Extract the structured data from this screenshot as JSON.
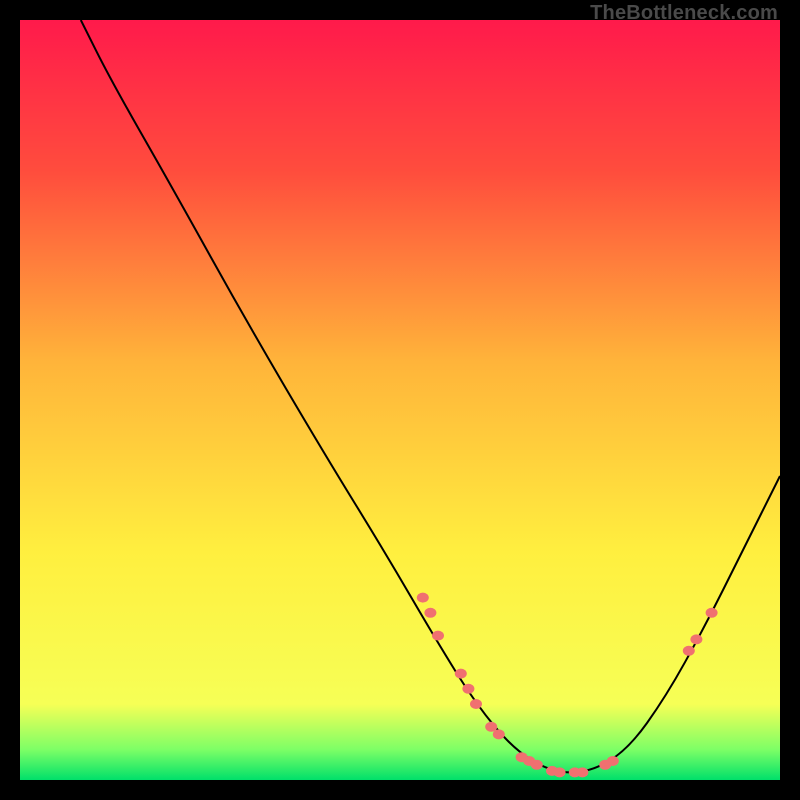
{
  "watermark": "TheBottleneck.com",
  "chart_data": {
    "type": "line",
    "title": "",
    "xlabel": "",
    "ylabel": "",
    "xlim": [
      0,
      100
    ],
    "ylim": [
      0,
      100
    ],
    "background_gradient": {
      "stops": [
        {
          "offset": 0,
          "color": "#ff1a4b"
        },
        {
          "offset": 20,
          "color": "#ff4d3d"
        },
        {
          "offset": 45,
          "color": "#ffb43a"
        },
        {
          "offset": 70,
          "color": "#ffef3f"
        },
        {
          "offset": 90,
          "color": "#f6ff56"
        },
        {
          "offset": 96,
          "color": "#7dff66"
        },
        {
          "offset": 100,
          "color": "#00e06a"
        }
      ]
    },
    "curve": [
      {
        "x": 8,
        "y": 100
      },
      {
        "x": 12,
        "y": 92
      },
      {
        "x": 20,
        "y": 78
      },
      {
        "x": 30,
        "y": 60
      },
      {
        "x": 40,
        "y": 43
      },
      {
        "x": 48,
        "y": 30
      },
      {
        "x": 55,
        "y": 18
      },
      {
        "x": 60,
        "y": 10
      },
      {
        "x": 65,
        "y": 4
      },
      {
        "x": 70,
        "y": 1
      },
      {
        "x": 75,
        "y": 1
      },
      {
        "x": 80,
        "y": 4
      },
      {
        "x": 85,
        "y": 11
      },
      {
        "x": 90,
        "y": 20
      },
      {
        "x": 95,
        "y": 30
      },
      {
        "x": 100,
        "y": 40
      }
    ],
    "markers": [
      {
        "x": 53,
        "y": 24
      },
      {
        "x": 54,
        "y": 22
      },
      {
        "x": 55,
        "y": 19
      },
      {
        "x": 58,
        "y": 14
      },
      {
        "x": 59,
        "y": 12
      },
      {
        "x": 60,
        "y": 10
      },
      {
        "x": 62,
        "y": 7
      },
      {
        "x": 63,
        "y": 6
      },
      {
        "x": 66,
        "y": 3
      },
      {
        "x": 67,
        "y": 2.5
      },
      {
        "x": 68,
        "y": 2
      },
      {
        "x": 70,
        "y": 1.2
      },
      {
        "x": 71,
        "y": 1
      },
      {
        "x": 73,
        "y": 1
      },
      {
        "x": 74,
        "y": 1
      },
      {
        "x": 77,
        "y": 2
      },
      {
        "x": 78,
        "y": 2.5
      },
      {
        "x": 88,
        "y": 17
      },
      {
        "x": 89,
        "y": 18.5
      },
      {
        "x": 91,
        "y": 22
      }
    ],
    "marker_color": "#f07070",
    "line_color": "#000000"
  }
}
